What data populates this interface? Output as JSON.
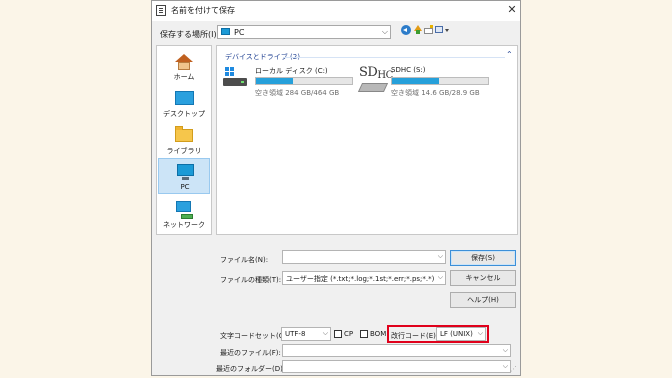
{
  "window": {
    "title": "名前を付けて保存",
    "close_glyph": "✕"
  },
  "location": {
    "label": "保存する場所(I):",
    "value": "PC"
  },
  "nav": {
    "items": [
      {
        "label": "ホーム"
      },
      {
        "label": "デスクトップ"
      },
      {
        "label": "ライブラリ"
      },
      {
        "label": "PC",
        "selected": true
      },
      {
        "label": "ネットワーク"
      }
    ]
  },
  "devices": {
    "header": "デバイスとドライブ (2)",
    "drives": [
      {
        "name": "ローカル ディスク (C:)",
        "free_text": "空き領域 284 GB/464 GB",
        "used_fraction": 0.39
      },
      {
        "name": "SDHC (S:)",
        "free_text": "空き領域 14.6 GB/28.9 GB",
        "used_fraction": 0.49,
        "logo_text": "SD",
        "logo_sub": "HC"
      }
    ]
  },
  "form": {
    "filename_label": "ファイル名(N):",
    "filename_value": "",
    "filetype_label": "ファイルの種類(T):",
    "filetype_value": "ユーザー指定 (*.txt;*.log;*.1st;*.err;*.ps;*.*)",
    "save_button": "保存(S)",
    "cancel_button": "キャンセル",
    "help_button": "ヘルプ(H)",
    "encoding_label": "文字コードセット(C):",
    "encoding_value": "UTF-8",
    "cp_label": "CP",
    "bom_label": "BOM",
    "newline_label": "改行コード(E):",
    "newline_value": "LF (UNIX)",
    "recent_file_label": "最近のファイル(F):",
    "recent_folder_label": "最近のフォルダー(D):"
  },
  "colors": {
    "accent": "#26a0da",
    "highlight": "#e0001b",
    "background": "#fbf5e8"
  }
}
